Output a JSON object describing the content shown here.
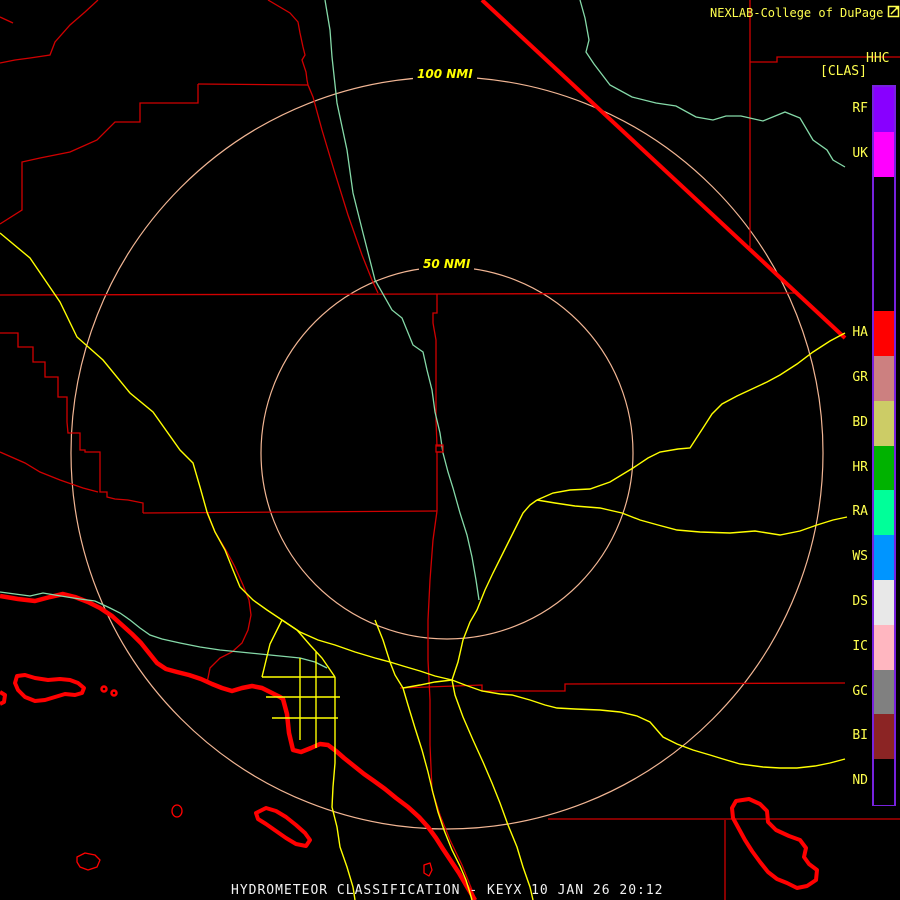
{
  "header": {
    "brand": "NEXLAB-College of DuPage",
    "brand_icon": "external-link-icon",
    "product_code": "HHC",
    "product_mode": "[CLAS]"
  },
  "footer": {
    "title": "HYDROMETEOR CLASSIFICATION - KEYX 10 JAN 26 20:12",
    "product": "HYDROMETEOR CLASSIFICATION",
    "station": "KEYX",
    "date": "10 JAN 26",
    "time": "20:12"
  },
  "range_rings": {
    "outer_label": "100 NMI",
    "inner_label": "50 NMI",
    "color": "#f2b694"
  },
  "legend": {
    "title": "HHC",
    "subtitle": "[CLAS]",
    "border_color": "#7722dd",
    "rows": [
      {
        "label": "RF",
        "color": "#8800ff",
        "row": 0
      },
      {
        "label": "UK",
        "color": "#ff00ff",
        "row": 1
      },
      {
        "label": "HA",
        "color": "#ff0000",
        "row": 5
      },
      {
        "label": "GR",
        "color": "#cc8080",
        "row": 6
      },
      {
        "label": "BD",
        "color": "#cccc66",
        "row": 7
      },
      {
        "label": "HR",
        "color": "#00b200",
        "row": 8
      },
      {
        "label": "RA",
        "color": "#00ff99",
        "row": 9
      },
      {
        "label": "WS",
        "color": "#0095ff",
        "row": 10
      },
      {
        "label": "DS",
        "color": "#e8e8e8",
        "row": 11
      },
      {
        "label": "IC",
        "color": "#ffb6c0",
        "row": 12
      },
      {
        "label": "GC",
        "color": "#808080",
        "row": 13
      },
      {
        "label": "BI",
        "color": "#8b2424",
        "row": 14
      },
      {
        "label": "ND",
        "color": "#000000",
        "row": 15
      }
    ]
  },
  "map_layers": {
    "county_lines_color": "#d00000",
    "state_border_color": "#ff0000",
    "coastline_color": "#ff0000",
    "highways_color": "#ffff00",
    "rivers_color": "#85d9a8",
    "background_color": "#000000"
  }
}
